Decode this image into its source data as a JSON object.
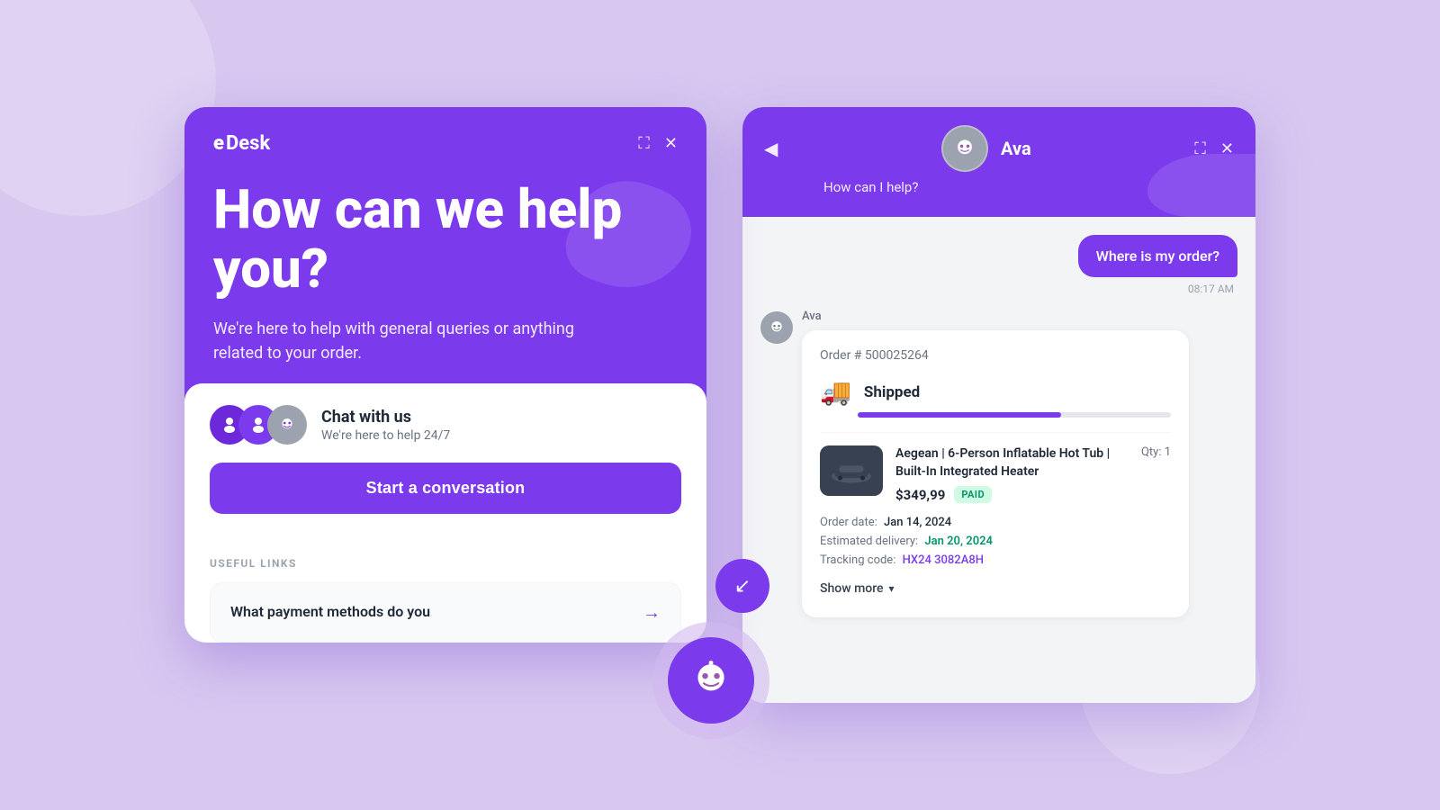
{
  "background": {
    "color": "#d8c8f0"
  },
  "left_panel": {
    "logo": "eDesk",
    "expand_icon": "⛶",
    "close_icon": "✕",
    "hero": {
      "title": "How can we help you?",
      "subtitle": "We're here to help with general queries or anything related to your order."
    },
    "chat_option": {
      "title": "Chat with us",
      "subtitle": "We're here to help 24/7"
    },
    "start_button_label": "Start a conversation",
    "useful_links": {
      "section_label": "USEFUL LINKS",
      "items": [
        {
          "text": "What payment methods do you"
        }
      ]
    }
  },
  "right_panel": {
    "back_icon": "◀",
    "expand_icon": "⛶",
    "close_icon": "✕",
    "agent": {
      "name": "Ava",
      "subtitle": "How can I help?"
    },
    "messages": [
      {
        "type": "user",
        "text": "Where is my order?",
        "timestamp": "08:17 AM"
      },
      {
        "type": "bot",
        "sender": "Ava",
        "order": {
          "number": "Order # 500025264",
          "status": "Shipped",
          "progress_percent": 65,
          "product": {
            "name": "Aegean | 6-Person Inflatable Hot Tub | Built-In Integrated Heater",
            "qty": "Qty: 1",
            "price": "$349,99",
            "paid_badge": "PAID"
          },
          "order_date_label": "Order date:",
          "order_date_value": "Jan 14, 2024",
          "delivery_label": "Estimated delivery:",
          "delivery_value": "Jan 20, 2024",
          "tracking_label": "Tracking code:",
          "tracking_code": "HX24 3082A8H"
        }
      }
    ],
    "show_more_label": "Show more"
  }
}
